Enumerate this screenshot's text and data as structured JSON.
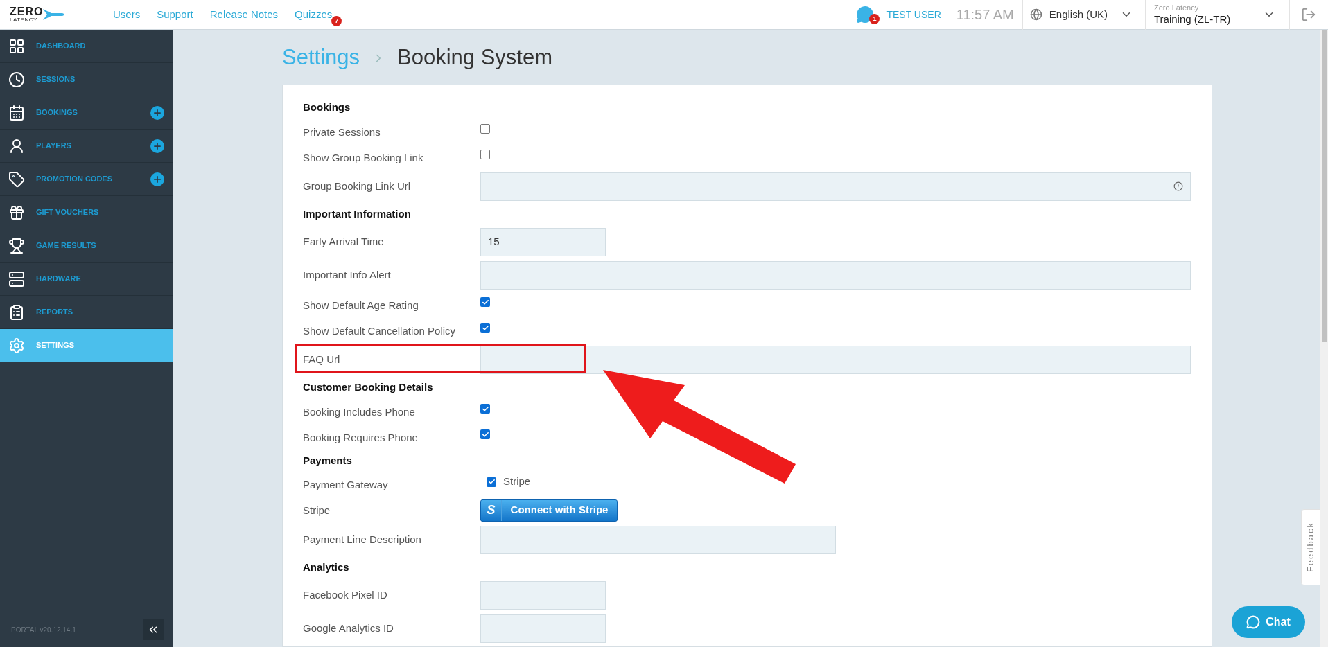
{
  "logo": {
    "line1": "ZERO",
    "line2": "LATENCY"
  },
  "nav_links": [
    {
      "label": "Users"
    },
    {
      "label": "Support"
    },
    {
      "label": "Release Notes"
    },
    {
      "label": "Quizzes",
      "badge": "7"
    }
  ],
  "notifications": {
    "badge": "1"
  },
  "user": "TEST USER",
  "time": "11:57 AM",
  "language": "English (UK)",
  "organization": {
    "label": "Zero Latency",
    "value": "Training (ZL-TR)"
  },
  "sidebar": {
    "items": [
      {
        "label": "DASHBOARD",
        "selected": false,
        "add_button": false
      },
      {
        "label": "SESSIONS",
        "selected": false,
        "add_button": false
      },
      {
        "label": "BOOKINGS",
        "selected": false,
        "add_button": true
      },
      {
        "label": "PLAYERS",
        "selected": false,
        "add_button": true
      },
      {
        "label": "PROMOTION CODES",
        "selected": false,
        "add_button": true
      },
      {
        "label": "GIFT VOUCHERS",
        "selected": false,
        "add_button": false
      },
      {
        "label": "GAME RESULTS",
        "selected": false,
        "add_button": false
      },
      {
        "label": "HARDWARE",
        "selected": false,
        "add_button": false
      },
      {
        "label": "REPORTS",
        "selected": false,
        "add_button": false
      },
      {
        "label": "SETTINGS",
        "selected": true,
        "add_button": false
      }
    ],
    "version": "PORTAL v20.12.14.1"
  },
  "breadcrumb": [
    {
      "label": "Settings"
    },
    {
      "label": "Booking System"
    }
  ],
  "form": {
    "sections": [
      {
        "heading": "Bookings",
        "fields": [
          {
            "kind": "checkbox",
            "label": "Private Sessions",
            "checked": false
          },
          {
            "kind": "checkbox",
            "label": "Show Group Booking Link",
            "checked": false
          },
          {
            "kind": "wide",
            "label": "Group Booking Link Url",
            "has_icon": true
          }
        ]
      },
      {
        "heading": "Important Information",
        "fields": [
          {
            "kind": "short",
            "label": "Early Arrival Time",
            "value": "15"
          },
          {
            "kind": "wide",
            "label": "Important Info Alert"
          },
          {
            "kind": "checkbox",
            "label": "Show Default Age Rating",
            "checked": true
          },
          {
            "kind": "checkbox",
            "label": "Show Default Cancellation Policy",
            "checked": true
          },
          {
            "kind": "wide",
            "label": "FAQ Url",
            "highlighted": true
          }
        ]
      },
      {
        "heading": "Customer Booking Details",
        "fields": [
          {
            "kind": "checkbox",
            "label": "Booking Includes Phone",
            "checked": true
          },
          {
            "kind": "checkbox",
            "label": "Booking Requires Phone",
            "checked": true
          }
        ]
      },
      {
        "heading": "Payments",
        "fields": [
          {
            "kind": "option",
            "label": "Payment Gateway",
            "checked": true,
            "option": "Stripe"
          },
          {
            "kind": "button",
            "label": "Stripe",
            "button_icon": "S",
            "button": "Connect with Stripe"
          },
          {
            "kind": "medium",
            "label": "Payment Line Description"
          }
        ]
      },
      {
        "heading": "Analytics",
        "fields": [
          {
            "kind": "short",
            "label": "Facebook Pixel ID"
          },
          {
            "kind": "short",
            "label": "Google Analytics ID"
          }
        ]
      }
    ]
  },
  "feedback_tab": "Feedback",
  "chat_button": "Chat"
}
